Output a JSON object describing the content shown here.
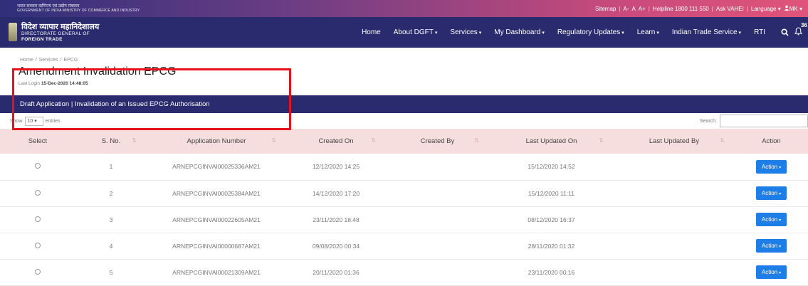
{
  "topbar": {
    "gov_hindi": "भारत सरकार  वाणिज्य एवं उद्योग मंत्रालय",
    "gov_english": "GOVERNMENT OF INDIA   MINISTRY OF COMMERCE AND INDUSTRY",
    "links": [
      "Sitemap",
      "A-",
      "A",
      "A+",
      "Helpline 1800 111 550",
      "Ask VAHEI",
      "Language",
      "MK"
    ],
    "caret": "▾"
  },
  "brand": {
    "hindi": "विदेश व्यापार महानिदेशालय",
    "line1": "DIRECTORATE GENERAL OF",
    "line2": "FOREIGN TRADE"
  },
  "nav": {
    "items": [
      {
        "label": "Home",
        "dropdown": false
      },
      {
        "label": "About DGFT",
        "dropdown": true
      },
      {
        "label": "Services",
        "dropdown": true
      },
      {
        "label": "My Dashboard",
        "dropdown": true
      },
      {
        "label": "Regulatory Updates",
        "dropdown": true
      },
      {
        "label": "Learn",
        "dropdown": true
      },
      {
        "label": "Indian Trade Service",
        "dropdown": true
      },
      {
        "label": "RTI",
        "dropdown": false
      }
    ],
    "notification_count": "36"
  },
  "breadcrumb": [
    "Home",
    "Services",
    "EPCG"
  ],
  "page": {
    "title": "Amendment Invalidation EPCG",
    "last_login_label": "Last Login",
    "last_login_value": "15-Dec-2020 14:48:05"
  },
  "section": {
    "title": "Draft Application | Invalidation of an Issued EPCG Authorisation"
  },
  "controls": {
    "show_label": "Show",
    "entries_value": "10",
    "entries_label": "entries",
    "search_label": "Search:"
  },
  "table": {
    "columns": [
      "Select",
      "S. No.",
      "Application Number",
      "Created On",
      "Created By",
      "Last Updated On",
      "Last Updated By",
      "Action"
    ],
    "action_label": "Action",
    "rows": [
      {
        "sno": "1",
        "app_no": "ARNEPCGINVAI00025336AM21",
        "created_on": "12/12/2020 14:25",
        "created_by": "",
        "last_updated_on": "15/12/2020 14:52",
        "last_updated_by": ""
      },
      {
        "sno": "2",
        "app_no": "ARNEPCGINVAI00025384AM21",
        "created_on": "14/12/2020 17:20",
        "created_by": "",
        "last_updated_on": "15/12/2020 11:11",
        "last_updated_by": ""
      },
      {
        "sno": "3",
        "app_no": "ARNEPCGINVAI00022605AM21",
        "created_on": "23/11/2020 18:48",
        "created_by": "",
        "last_updated_on": "08/12/2020 16:37",
        "last_updated_by": ""
      },
      {
        "sno": "4",
        "app_no": "ARNEPCGINVAI00000687AM21",
        "created_on": "09/08/2020 00:34",
        "created_by": "",
        "last_updated_on": "28/11/2020 01:32",
        "last_updated_by": ""
      },
      {
        "sno": "5",
        "app_no": "ARNEPCGINVAI00021309AM21",
        "created_on": "20/11/2020 01:36",
        "created_by": "",
        "last_updated_on": "23/11/2020 00:16",
        "last_updated_by": ""
      }
    ]
  }
}
